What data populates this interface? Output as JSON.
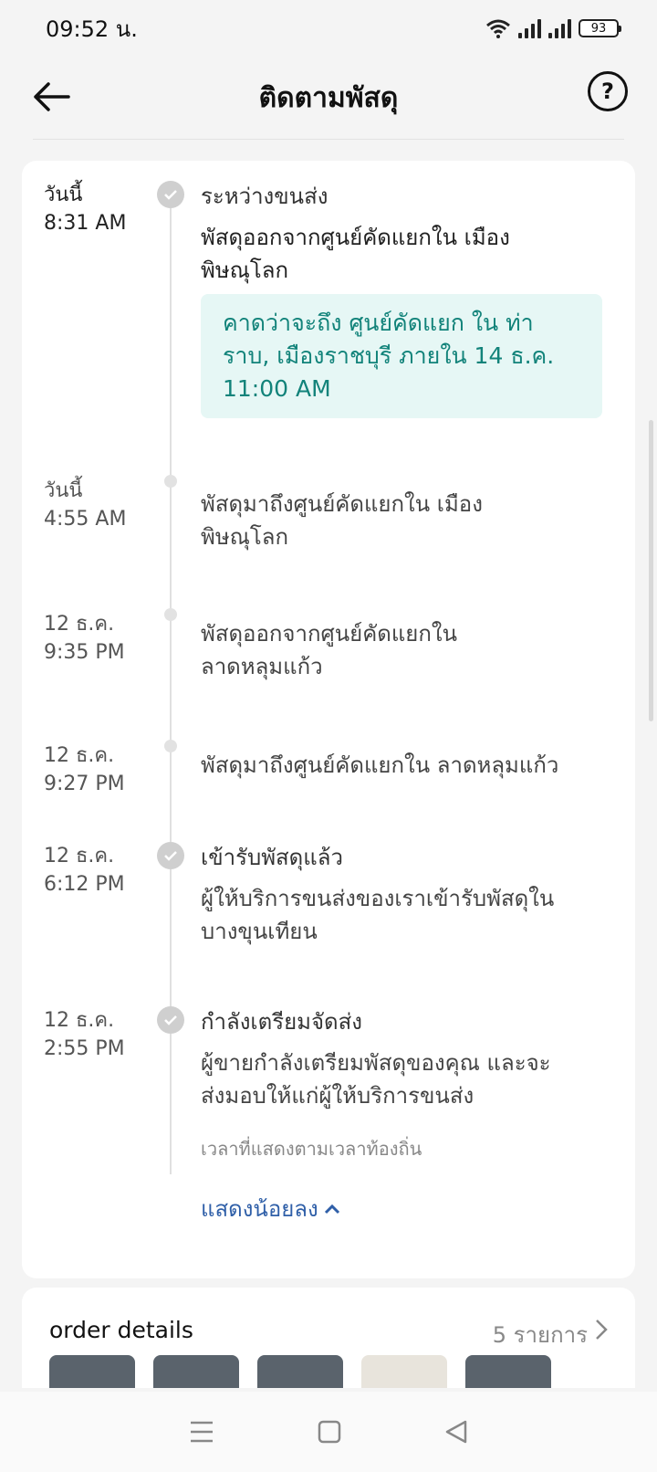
{
  "status_bar": {
    "time": "09:52 น.",
    "battery": "93"
  },
  "header": {
    "title": "ติดตามพัสดุ"
  },
  "timeline": [
    {
      "day": "วันนี้",
      "time": "8:31 AM",
      "title": "ระหว่างขนส่ง",
      "desc_lines": [
        "พัสดุออกจากศูนย์คัดแยกใน เมือง",
        "พิษณุโลก"
      ],
      "eta_lines": [
        "คาดว่าจะถึง ศูนย์คัดแยก ใน ท่า",
        "ราบ, เมืองราชบุรี ภายใน 14 ธ.ค.",
        "11:00 AM"
      ]
    },
    {
      "day": "วันนี้",
      "time": "4:55 AM",
      "desc_lines": [
        "พัสดุมาถึงศูนย์คัดแยกใน เมือง",
        "พิษณุโลก"
      ]
    },
    {
      "day": "12 ธ.ค.",
      "time": "9:35 PM",
      "desc_lines": [
        "พัสดุออกจากศูนย์คัดแยกใน",
        "ลาดหลุมแก้ว"
      ]
    },
    {
      "day": "12 ธ.ค.",
      "time": "9:27 PM",
      "desc_lines": [
        "พัสดุมาถึงศูนย์คัดแยกใน ลาดหลุมแก้ว"
      ]
    },
    {
      "day": "12 ธ.ค.",
      "time": "6:12 PM",
      "title": "เข้ารับพัสดุแล้ว",
      "desc_lines": [
        "ผู้ให้บริการขนส่งของเราเข้ารับพัสดุใน",
        "บางขุนเทียน"
      ]
    },
    {
      "day": "12 ธ.ค.",
      "time": "2:55 PM",
      "title": "กำลังเตรียมจัดส่ง",
      "desc_lines": [
        "ผู้ขายกำลังเตรียมพัสดุของคุณ และจะ",
        "ส่งมอบให้แก่ผู้ให้บริการขนส่ง"
      ]
    }
  ],
  "note": "เวลาที่แสดงตามเวลาท้องถิ่น",
  "show_less": "แสดงน้อยลง",
  "order": {
    "title": "order details",
    "count": "5 รายการ"
  }
}
